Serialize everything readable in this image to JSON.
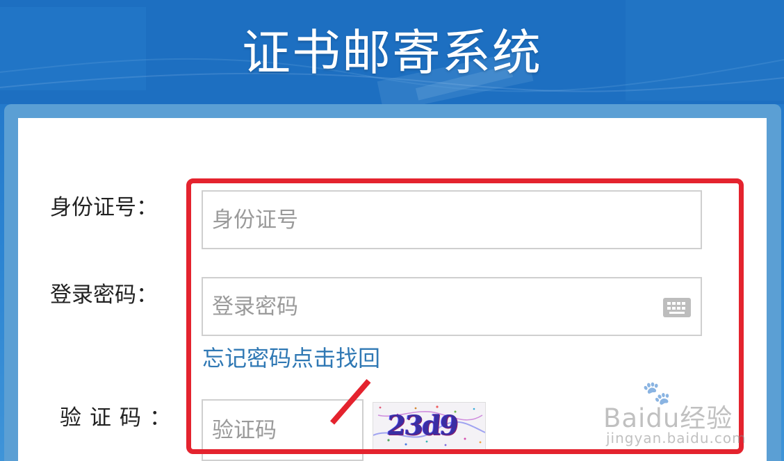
{
  "page": {
    "title": "证书邮寄系统"
  },
  "form": {
    "id_label": "身份证号：",
    "id_placeholder": "身份证号",
    "password_label": "登录密码：",
    "password_placeholder": "登录密码",
    "password_keyboard_icon": "keyboard-icon",
    "forgot_link": "忘记密码点击找回",
    "captcha_label": "验证码：",
    "captcha_placeholder": "验证码",
    "captcha_code": "23d9"
  },
  "watermark": {
    "brand": "Baidu经验",
    "url": "jingyan.baidu.com"
  },
  "colors": {
    "header_blue": "#1f73c6",
    "panel_blue": "#5b9fd4",
    "highlight_red": "#e4232e",
    "link_blue": "#2f78b4",
    "input_border": "#cfcfcf"
  }
}
